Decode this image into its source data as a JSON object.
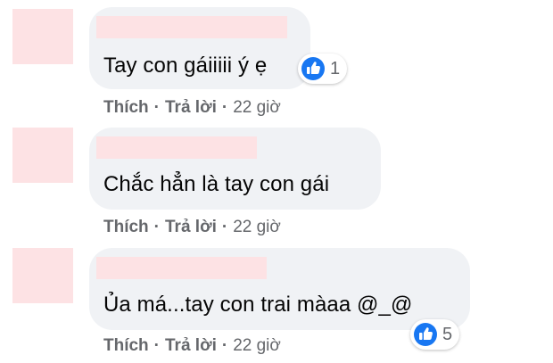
{
  "colors": {
    "bubble": "#f0f2f5",
    "redaction": "#fde2e4",
    "like_blue": "#1877f2",
    "meta_gray": "#65676b",
    "text": "#050505"
  },
  "comments": [
    {
      "text": "Tay con gáiiiii ý ẹ",
      "actions": {
        "like": "Thích",
        "reply": "Trả lời",
        "sep": "·",
        "time": "22 giờ"
      },
      "reaction": {
        "icon": "like-thumbs-up-icon",
        "count": "1"
      }
    },
    {
      "text": "Chắc hẳn là tay con gái",
      "actions": {
        "like": "Thích",
        "reply": "Trả lời",
        "sep": "·",
        "time": "22 giờ"
      }
    },
    {
      "text": "Ủa má...tay con trai màaa @_@",
      "actions": {
        "like": "Thích",
        "reply": "Trả lời",
        "sep": "·",
        "time": "22 giờ"
      },
      "reaction": {
        "icon": "like-thumbs-up-icon",
        "count": "5"
      }
    }
  ]
}
